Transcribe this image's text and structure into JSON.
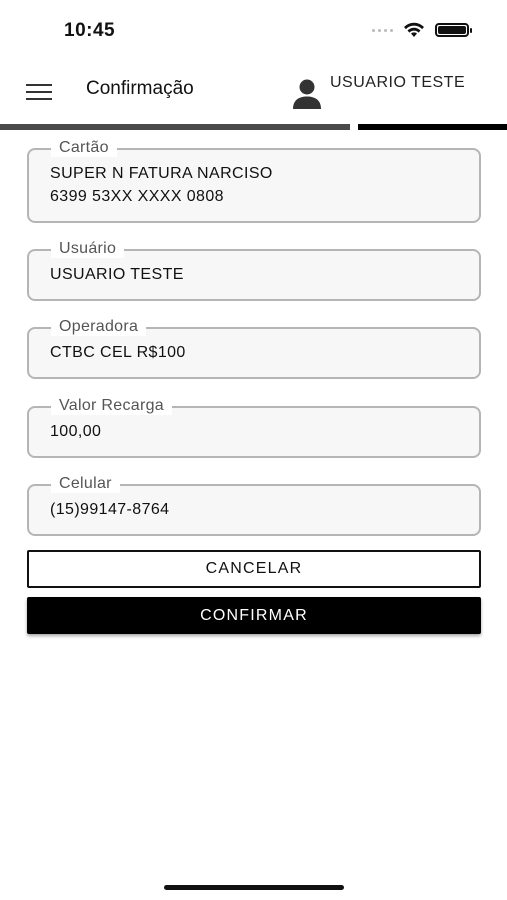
{
  "status_bar": {
    "time": "10:45"
  },
  "header": {
    "title": "Confirmação",
    "user_name": "USUARIO TESTE"
  },
  "progress": {
    "current_step": 2,
    "total_steps": 2
  },
  "fields": {
    "cartao": {
      "label": "Cartão",
      "line1": "SUPER N FATURA NARCISO",
      "line2": "6399 53XX XXXX 0808"
    },
    "usuario": {
      "label": "Usuário",
      "value": "USUARIO TESTE"
    },
    "operadora": {
      "label": "Operadora",
      "value": "CTBC CEL R$100"
    },
    "valor": {
      "label": "Valor Recarga",
      "value": "100,00"
    },
    "celular": {
      "label": "Celular",
      "value": "(15)99147-8764"
    }
  },
  "actions": {
    "cancel_label": "CANCELAR",
    "confirm_label": "CONFIRMAR"
  },
  "icons": {
    "menu": "hamburger-menu-icon",
    "user": "person-icon",
    "wifi": "wifi-icon",
    "battery": "battery-icon",
    "signal": "cellular-signal-icon"
  }
}
